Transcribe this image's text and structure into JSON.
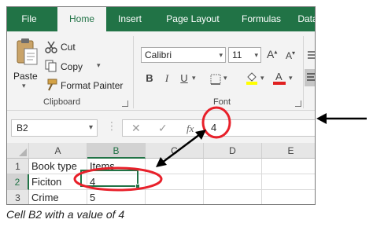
{
  "menu": {
    "tabs": [
      "File",
      "Home",
      "Insert",
      "Page Layout",
      "Formulas",
      "Data"
    ],
    "active_tab": "Home"
  },
  "ribbon": {
    "clipboard": {
      "paste": "Paste",
      "cut": "Cut",
      "copy": "Copy",
      "format_painter": "Format Painter",
      "group_label": "Clipboard"
    },
    "font": {
      "font_name": "Calibri",
      "font_size": "11",
      "bold": "B",
      "italic": "I",
      "underline": "U",
      "group_label": "Font"
    }
  },
  "formula_bar": {
    "name_box": "B2",
    "cancel_icon": "✕",
    "enter_icon": "✓",
    "function_icon": "fx",
    "formula_value": "4"
  },
  "grid": {
    "columns": [
      "A",
      "B",
      "C",
      "D",
      "E"
    ],
    "selected_column": "B",
    "rows": [
      {
        "row": "1",
        "A": "Book type",
        "B": "Items"
      },
      {
        "row": "2",
        "A": "Ficiton",
        "B": "4"
      },
      {
        "row": "3",
        "A": "Crime",
        "B": "5"
      }
    ],
    "active_cell": "B2"
  },
  "caption": "Cell B2 with a value of 4",
  "colors": {
    "excel_green": "#217346",
    "annotation_red": "#e8202a",
    "annotation_arrow": "#000000"
  }
}
